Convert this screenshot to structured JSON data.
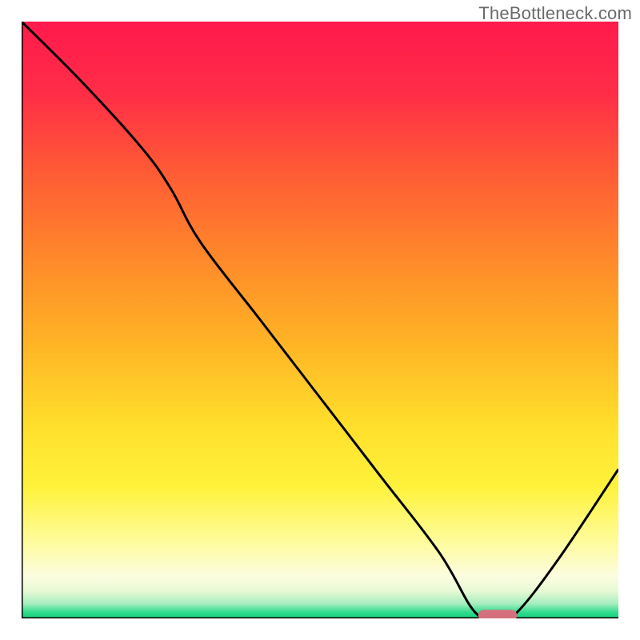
{
  "watermark": "TheBottleneck.com",
  "colors": {
    "gradient_stops": [
      {
        "offset": 0.0,
        "color": "#ff1a4d"
      },
      {
        "offset": 0.12,
        "color": "#ff2d47"
      },
      {
        "offset": 0.25,
        "color": "#ff5a35"
      },
      {
        "offset": 0.4,
        "color": "#ff8a2a"
      },
      {
        "offset": 0.55,
        "color": "#ffb725"
      },
      {
        "offset": 0.68,
        "color": "#ffe02c"
      },
      {
        "offset": 0.78,
        "color": "#fff23c"
      },
      {
        "offset": 0.86,
        "color": "#fffb8f"
      },
      {
        "offset": 0.93,
        "color": "#fcfde0"
      },
      {
        "offset": 0.955,
        "color": "#e6f9d4"
      },
      {
        "offset": 0.975,
        "color": "#a7eec0"
      },
      {
        "offset": 0.99,
        "color": "#2fdc8c"
      },
      {
        "offset": 1.0,
        "color": "#14d07f"
      }
    ],
    "curve_stroke": "#000000",
    "marker_fill": "#d6707e",
    "axis_stroke": "#000000"
  },
  "chart_data": {
    "type": "line",
    "title": "",
    "xlabel": "",
    "ylabel": "",
    "xlim": [
      0,
      100
    ],
    "ylim": [
      0,
      100
    ],
    "grid": false,
    "legend": false,
    "note": "Axes carry no tick labels. Values are visual estimates on a 0–100 normalized scale: x = horizontal position across the plotted region, y = vertical position where 0 is bottom and 100 is top. The curve descends from top-left, reaches a flat minimum near x≈76–83 at y≈0, then rises toward the right edge. A short capsule marker sits at the minimum.",
    "series": [
      {
        "name": "curve",
        "x": [
          0,
          10,
          20,
          25,
          30,
          40,
          50,
          60,
          70,
          76,
          80,
          83,
          90,
          100
        ],
        "y": [
          100,
          90,
          79,
          72,
          63,
          50,
          37,
          24,
          11,
          1,
          0,
          1,
          10,
          25
        ]
      }
    ],
    "marker": {
      "name": "optimum-range",
      "x_start": 76.5,
      "x_end": 83,
      "y": 0.5,
      "shape": "capsule"
    }
  }
}
